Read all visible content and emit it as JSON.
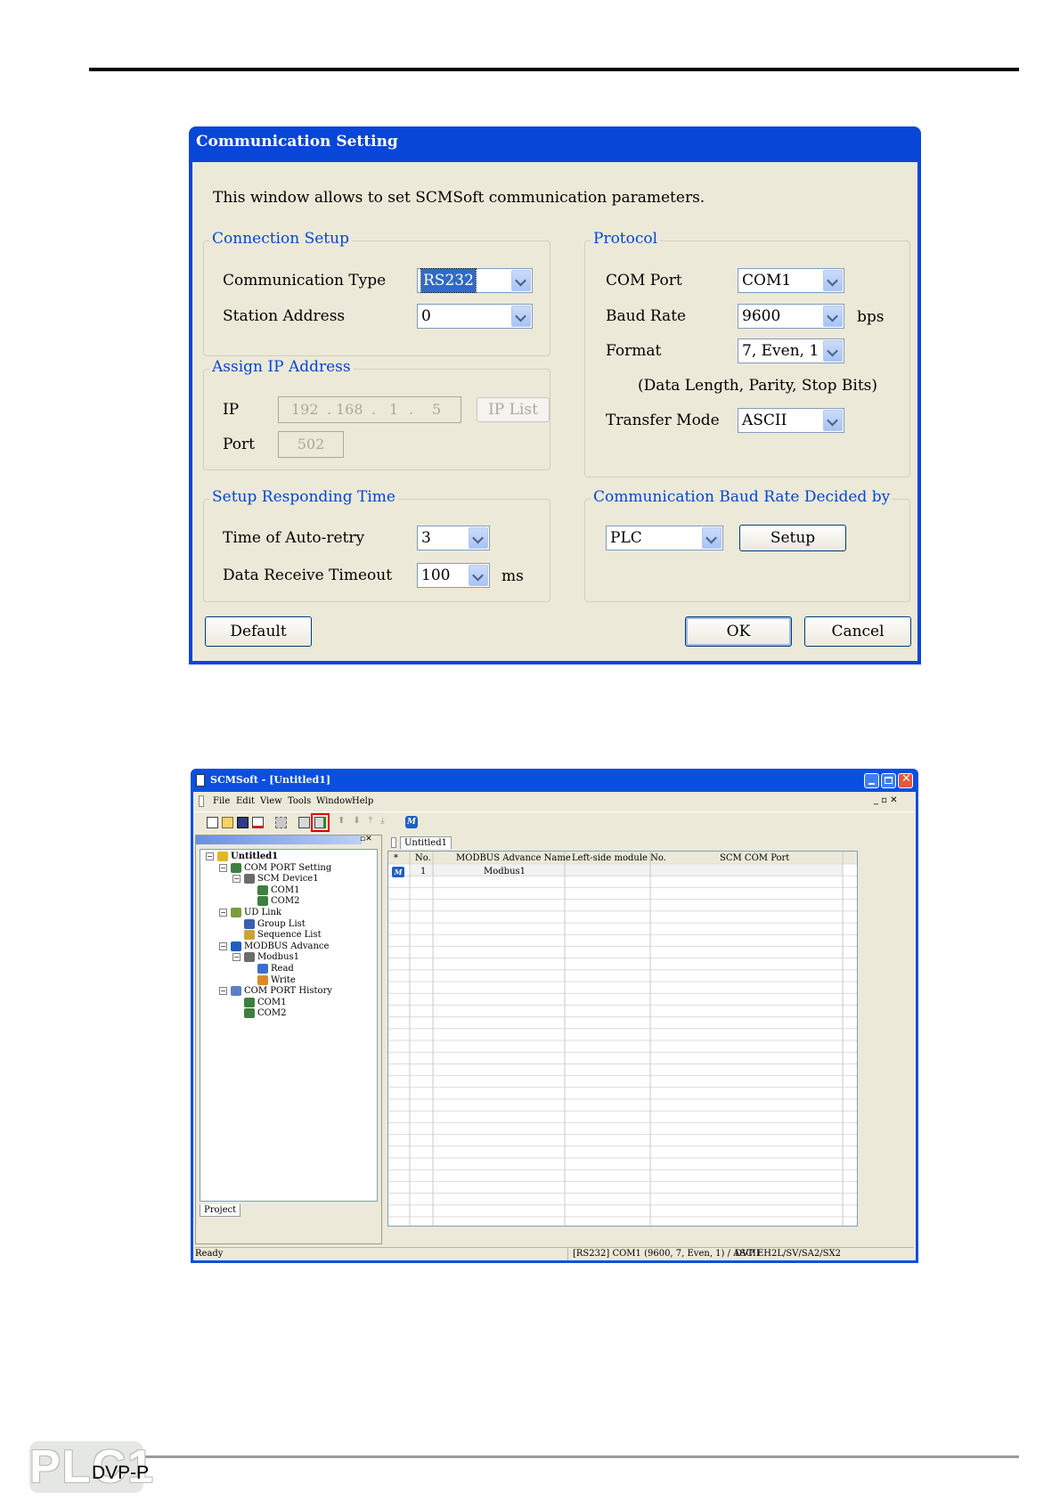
{
  "dialog": {
    "title": "Communication Setting",
    "intro": "This window allows to set  SCMSoft communication parameters.",
    "connection_setup": {
      "title": "Connection Setup",
      "comm_type_label": "Communication Type",
      "comm_type_value": "RS232",
      "station_label": "Station Address",
      "station_value": "0"
    },
    "assign_ip": {
      "title": "Assign IP Address",
      "ip_label": "IP",
      "ip_octets": [
        "192",
        "168",
        "1",
        "5"
      ],
      "ip_list_button": "IP List",
      "port_label": "Port",
      "port_value": "502"
    },
    "protocol": {
      "title": "Protocol",
      "com_port_label": "COM Port",
      "com_port_value": "COM1",
      "baud_label": "Baud Rate",
      "baud_value": "9600",
      "baud_unit": "bps",
      "format_label": "Format",
      "format_value": "7, Even, 1",
      "format_hint": "(Data Length, Parity, Stop Bits)",
      "transfer_label": "Transfer Mode",
      "transfer_value": "ASCII"
    },
    "responding": {
      "title": "Setup Responding Time",
      "retry_label": "Time of Auto-retry",
      "retry_value": "3",
      "timeout_label": "Data Receive Timeout",
      "timeout_value": "100",
      "timeout_unit": "ms"
    },
    "baud_decided": {
      "title": "Communication Baud Rate Decided by",
      "value": "PLC",
      "setup_button": "Setup"
    },
    "buttons": {
      "default": "Default",
      "ok": "OK",
      "cancel": "Cancel"
    }
  },
  "app": {
    "title": "SCMSoft - [Untitled1]",
    "menu": [
      "File",
      "Edit",
      "View",
      "Tools",
      "Window",
      "Help"
    ],
    "doc_tab": "Untitled1",
    "project_tab": "Project",
    "tree": [
      {
        "label": "Untitled1",
        "level": 0,
        "icon": "project-icon",
        "bold": true,
        "toggle": "minus"
      },
      {
        "label": "COM PORT Setting",
        "level": 1,
        "icon": "com-port-icon",
        "toggle": "minus"
      },
      {
        "label": "SCM Device1",
        "level": 2,
        "icon": "device-icon",
        "toggle": "minus"
      },
      {
        "label": "COM1",
        "level": 3,
        "icon": "port-icon"
      },
      {
        "label": "COM2",
        "level": 3,
        "icon": "port-icon"
      },
      {
        "label": "UD Link",
        "level": 1,
        "icon": "link-icon",
        "toggle": "minus"
      },
      {
        "label": "Group List",
        "level": 2,
        "icon": "group-list-icon"
      },
      {
        "label": "Sequence List",
        "level": 2,
        "icon": "sequence-list-icon"
      },
      {
        "label": "MODBUS Advance",
        "level": 1,
        "icon": "modbus-icon",
        "toggle": "minus"
      },
      {
        "label": "Modbus1",
        "level": 2,
        "icon": "device-icon",
        "toggle": "minus"
      },
      {
        "label": "Read",
        "level": 3,
        "icon": "read-icon"
      },
      {
        "label": "Write",
        "level": 3,
        "icon": "write-icon"
      },
      {
        "label": "COM PORT History",
        "level": 1,
        "icon": "history-icon",
        "toggle": "minus"
      },
      {
        "label": "COM1",
        "level": 2,
        "icon": "port-icon"
      },
      {
        "label": "COM2",
        "level": 2,
        "icon": "port-icon"
      }
    ],
    "table": {
      "headers": [
        "*",
        "No.",
        "MODBUS Advance Name",
        "Left-side module No.",
        "SCM COM Port"
      ],
      "rows": [
        [
          "",
          "1",
          "Modbus1",
          "",
          ""
        ]
      ]
    },
    "status": {
      "left": "Ready",
      "comm": "[RS232] COM1 (9600, 7, Even, 1) / ASCII",
      "model": "DVP EH2L/SV/SA2/SX2"
    }
  },
  "footer": {
    "logo": "PLC1",
    "text": "DVP-P"
  },
  "colors": {
    "xp_blue": "#0846d8",
    "dialog_bg": "#ece9d8",
    "group_title": "#0046d5",
    "highlight_box": "#e00000"
  }
}
